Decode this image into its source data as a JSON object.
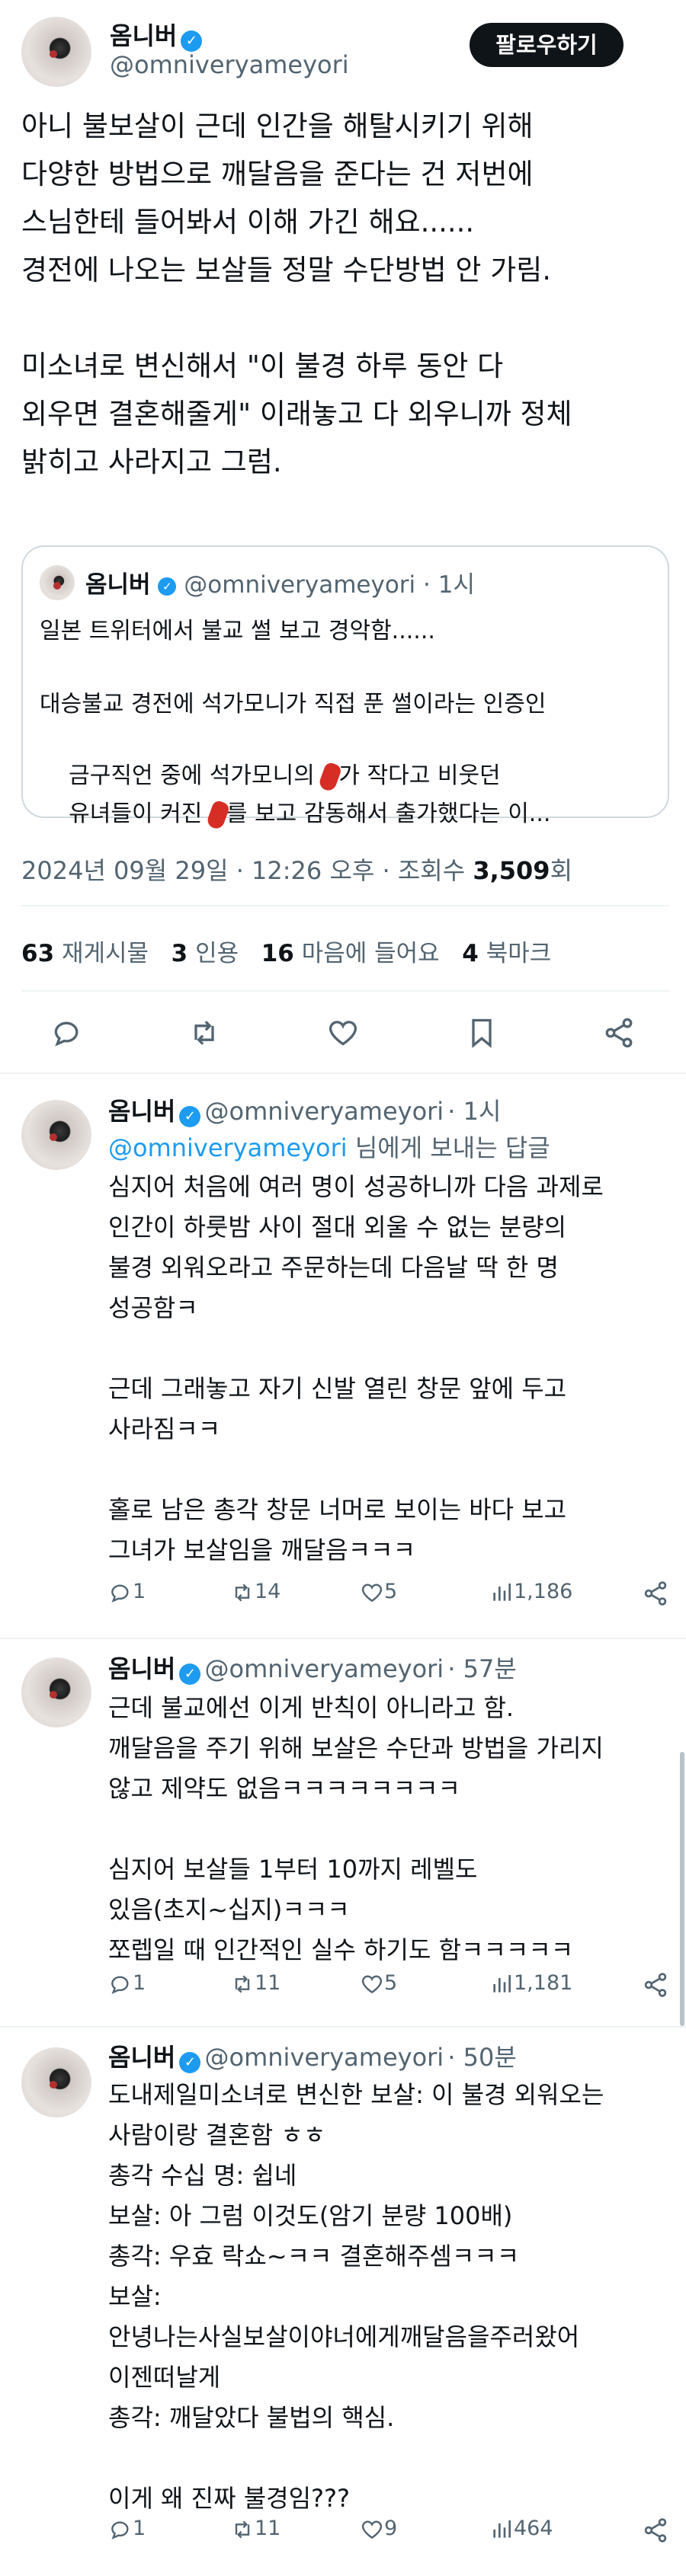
{
  "main_tweet": {
    "author_name": "옴니버",
    "handle": "@omniveryameyori",
    "follow_label": "팔로우하기",
    "body": "아니 불보살이 근데 인간을 해탈시키기 위해\n다양한 방법으로 깨달음을 준다는 건 저번에\n스님한테 들어봐서 이해 가긴 해요......\n경전에 나오는 보살들 정말 수단방법 안 가림.\n\n미소녀로 변신해서 \"이 불경 하루 동안 다\n외우면 결혼해줄게\" 이래놓고 다 외우니까 정체\n밝히고 사라지고 그럼.",
    "quote": {
      "author_name": "옴니버",
      "handle": "@omniveryameyori",
      "time": "· 1시",
      "line1": "일본 트위터에서 불교 썰 보고 경악함......",
      "line2": "대승불교 경전에 석가모니가 직접 푼 썰이라는 인증인",
      "line3a": "금구직언 중에 석가모니의 ",
      "line3b": "가 작다고 비웃던",
      "line4a": "유녀들이 커진 ",
      "line4b": "를 보고 감동해서 출가했다는 이..."
    },
    "timestamp_a": "2024년 09월 29일 · 12:26 오후 · 조회수 ",
    "views": "3,509",
    "timestamp_b": "회",
    "stats": {
      "retweets_num": "63",
      "retweets_label": "재게시물",
      "quotes_num": "3",
      "quotes_label": "인용",
      "likes_num": "16",
      "likes_label": "마음에 들어요",
      "bookmarks_num": "4",
      "bookmarks_label": "북마크"
    }
  },
  "replies": [
    {
      "author_name": "옴니버",
      "handle": "@omniveryameyori",
      "time": "· 1시",
      "reply_to_mention": "@omniveryameyori",
      "reply_to_suffix": " 님에게 보내는 답글",
      "body": "심지어 처음에 여러 명이 성공하니까 다음 과제로\n인간이 하룻밤 사이 절대 외울 수 없는 분량의\n불경 외워오라고 주문하는데 다음날 딱 한 명\n성공함ㅋ\n\n근데 그래놓고 자기 신발 열린 창문 앞에 두고\n사라짐ㅋㅋ\n\n홀로 남은 총각 창문 너머로 보이는 바다 보고\n그녀가 보살임을 깨달음ㅋㅋㅋ",
      "replies": "1",
      "retweets": "14",
      "likes": "5",
      "views": "1,186"
    },
    {
      "author_name": "옴니버",
      "handle": "@omniveryameyori",
      "time": "· 57분",
      "body": "근데 불교에선 이게 반칙이 아니라고 함.\n깨달음을 주기 위해 보살은 수단과 방법을 가리지\n않고 제약도 없음ㅋㅋㅋㅋㅋㅋㅋㅋ\n\n심지어 보살들 1부터 10까지 레벨도\n있음(초지~십지)ㅋㅋㅋ\n쪼렙일 때 인간적인 실수 하기도 함ㅋㅋㅋㅋㅋ",
      "replies": "1",
      "retweets": "11",
      "likes": "5",
      "views": "1,181"
    },
    {
      "author_name": "옴니버",
      "handle": "@omniveryameyori",
      "time": "· 50분",
      "body": "도내제일미소녀로 변신한 보살: 이 불경 외워오는\n사람이랑 결혼함 ㅎㅎ\n총각 수십 명: 쉽네\n보살: 아 그럼 이것도(암기 분량 100배)\n총각: 우효 락쇼~ㅋㅋ 결혼해주셈ㅋㅋㅋ\n보살:\n안녕나는사실보살이야너에게깨달음을주러왔어\n이젠떠날게\n총각: 깨달았다 불법의 핵심.\n\n이게 왜 진짜 불경임???",
      "replies": "1",
      "retweets": "11",
      "likes": "9",
      "views": "464"
    }
  ],
  "colors": {
    "accent": "#1d9bf0",
    "text": "#0f1419",
    "muted": "#536471",
    "divider": "#eff3f4"
  }
}
